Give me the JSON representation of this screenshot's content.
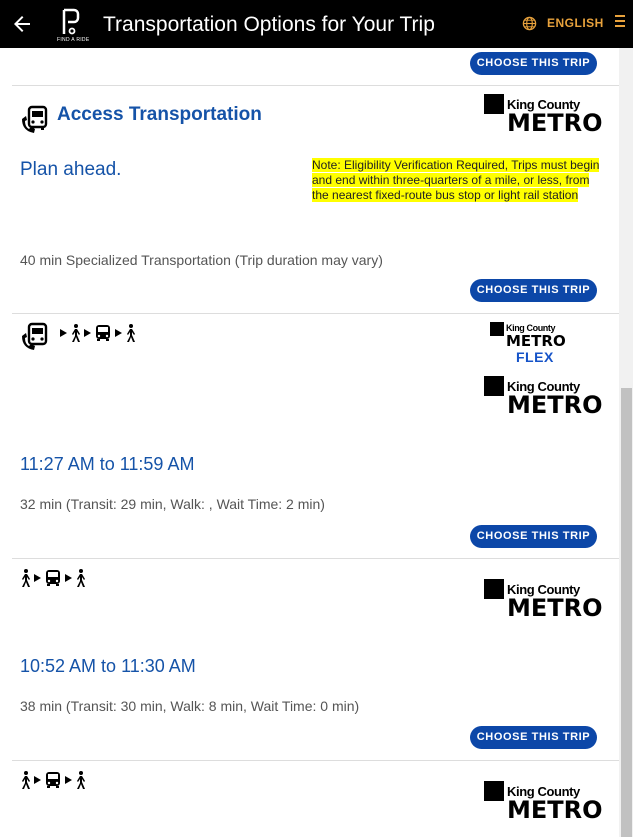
{
  "header": {
    "title": "Transportation Options for Your Trip",
    "logo_text": "FIND A RIDE",
    "language_label": "ENGLISH",
    "accent_color": "#e8a23c"
  },
  "choose_label": "CHOOSE THIS TRIP",
  "access": {
    "title": "Access Transportation",
    "plan_text": "Plan ahead.",
    "note": "Note: Eligibility Verification Required, Trips must begin and end within three-quarters of a mile, or less, from the nearest fixed-route bus stop or light rail station",
    "duration": "40 min Specialized Transportation (Trip duration may vary)"
  },
  "provider": {
    "name": "King County",
    "brand": "METRO",
    "flex": "FLEX"
  },
  "trips": [
    {
      "time": "11:27 AM to 11:59 AM",
      "duration": "32 min (Transit: 29 min, Walk: , Wait Time: 2 min)"
    },
    {
      "time": "10:52 AM to 11:30 AM",
      "duration": "38 min (Transit: 30 min, Walk: 8 min, Wait Time: 0 min)"
    }
  ],
  "brand_color": "#0c47a8"
}
